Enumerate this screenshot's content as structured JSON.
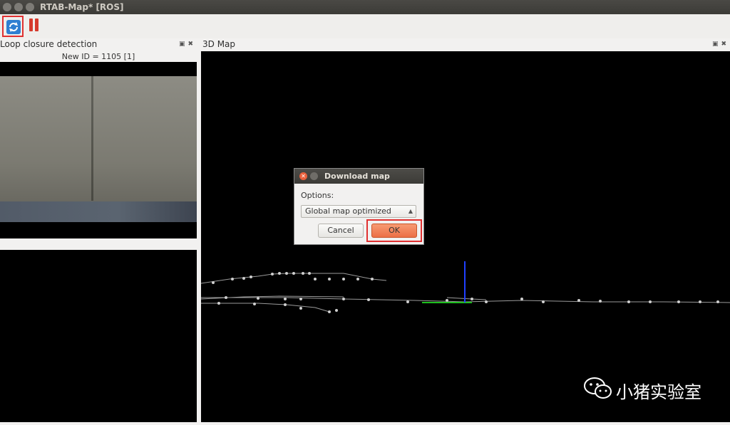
{
  "window": {
    "title": "RTAB-Map* [ROS]"
  },
  "toolbar": {
    "refresh_icon": "refresh-icon",
    "pause_icon": "pause-icon"
  },
  "loop_panel": {
    "title": "Loop closure detection",
    "new_id_text": "New ID = 1105 [1]"
  },
  "map_panel": {
    "title": "3D Map"
  },
  "dialog": {
    "title": "Download map",
    "options_label": "Options:",
    "selected_option": "Global map optimized",
    "cancel_label": "Cancel",
    "ok_label": "OK"
  },
  "watermark": {
    "text": "小猪实验室"
  },
  "colors": {
    "accent": "#ec7046",
    "highlight_box": "#e03030",
    "map_background": "#000000"
  }
}
